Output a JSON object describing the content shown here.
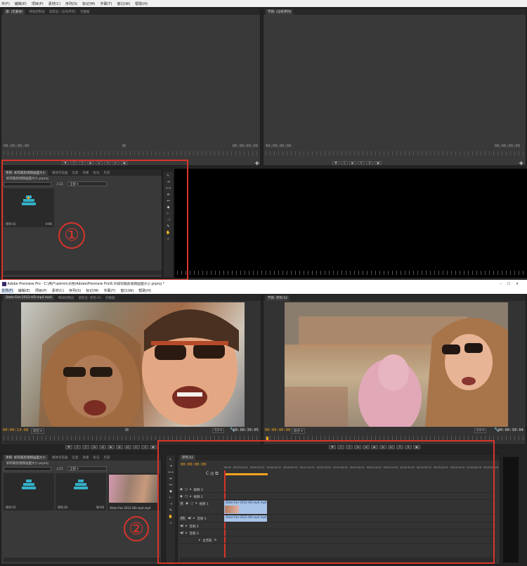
{
  "top": {
    "menu": [
      "件(F)",
      "编辑(E)",
      "项目(P)",
      "素材(C)",
      "序列(S)",
      "标记(M)",
      "字幕(T)",
      "窗口(W)",
      "帮助(H)"
    ],
    "source_tabs": [
      "源: (无素材)",
      "特效控制台",
      "调音台: (没有序列)",
      "元数据"
    ],
    "program_tab": "节目: (没有序列)",
    "source_timecode_left": "00;00;00;00",
    "source_timecode_right": "00;00;00;00",
    "program_timecode_left": "00;00;00;00",
    "program_timecode_right": "00;00;00;00",
    "project_tabs": [
      "项目: 如何裁剪视频画面大小",
      "媒体浏览器",
      "信息",
      "效果",
      "标记",
      "历史"
    ],
    "project_file": "如何裁剪视频画面大小.prproj",
    "in_label": "入口:",
    "in_value": "全部",
    "bin_item_name": "序列 01",
    "bin_item_duration": "0:00",
    "annotation": "①"
  },
  "bottom": {
    "title": "Adobe Premiere Pro - C:\\用户\\admin\\文档\\Adobe\\Premiere Pro\\6.0\\如何裁剪视频画面大小.prproj *",
    "menu": [
      "文件(F)",
      "编辑(E)",
      "项目(P)",
      "素材(C)",
      "序列(S)",
      "标记(M)",
      "字幕(T)",
      "窗口(W)",
      "帮助(H)"
    ],
    "source_tab": "State-Fair-2012-HD.mp4.mp4",
    "source_tabs_rest": [
      "特效控制台",
      "调音台: 序列 01",
      "元数据"
    ],
    "program_tab": "节目: 序列 02",
    "source_timecode_left": "00:00:13:08",
    "source_fit": "适合",
    "source_ratio": "1/2",
    "source_timecode_right": "00:00:30:05",
    "program_timecode_left": "00:00:00:00",
    "program_fit": "适合",
    "program_ratio": "1/2",
    "program_timecode_right": "00:00:30:04",
    "project_tabs": [
      "项目: 如何裁剪视频画面大小",
      "媒体浏览器",
      "信息",
      "效果",
      "标记",
      "历史"
    ],
    "project_file": "如何裁剪视频画面大小.prproj",
    "in_label": "入口:",
    "in_value": "全部",
    "bin_items": [
      {
        "name": "序列 01",
        "duration": ""
      },
      {
        "name": "序列 02",
        "duration": "30:04"
      },
      {
        "name": "State-Fair-2012-HD.mp4.mp4",
        "duration": ""
      }
    ],
    "timeline_tab": "序列 02",
    "timeline_timecode": "00:00:00:00",
    "ruler_labels": [
      "00:00",
      "00:00:14:23",
      "00:00:29:23",
      "00:00:44:22",
      "00:00:59:22",
      "00:01:14:22",
      "00:01:29:21",
      "00:01:44:21",
      "00:01:59:21",
      "00:02:14:20",
      "00:02:29:20",
      "00:02:44:20",
      "00:02:59:19",
      "00:03:14:19",
      "00:03:29:19",
      "00:03:44:18",
      "00:03:59:18"
    ],
    "tracks": [
      {
        "label": "视频 3",
        "type": "video"
      },
      {
        "label": "视频 2",
        "type": "video"
      },
      {
        "label": "视频 1",
        "type": "video",
        "badge": "V"
      },
      {
        "label": "音频 1",
        "type": "audio",
        "badge": "A1"
      },
      {
        "label": "音频 2",
        "type": "audio"
      },
      {
        "label": "音频 3",
        "type": "audio"
      },
      {
        "label": "主音轨",
        "type": "master"
      }
    ],
    "video_clip": "State-Fair-2012-HD.mp4.mp4",
    "audio_clip": "State-Fair-2012-HD.mp4.mp4",
    "annotation": "②"
  },
  "colors": {
    "annotation_red": "#d9342b",
    "timecode_orange": "#f0a21e",
    "clip_blue": "#a8c4e8",
    "sequence_icon": "#34b0c8"
  }
}
